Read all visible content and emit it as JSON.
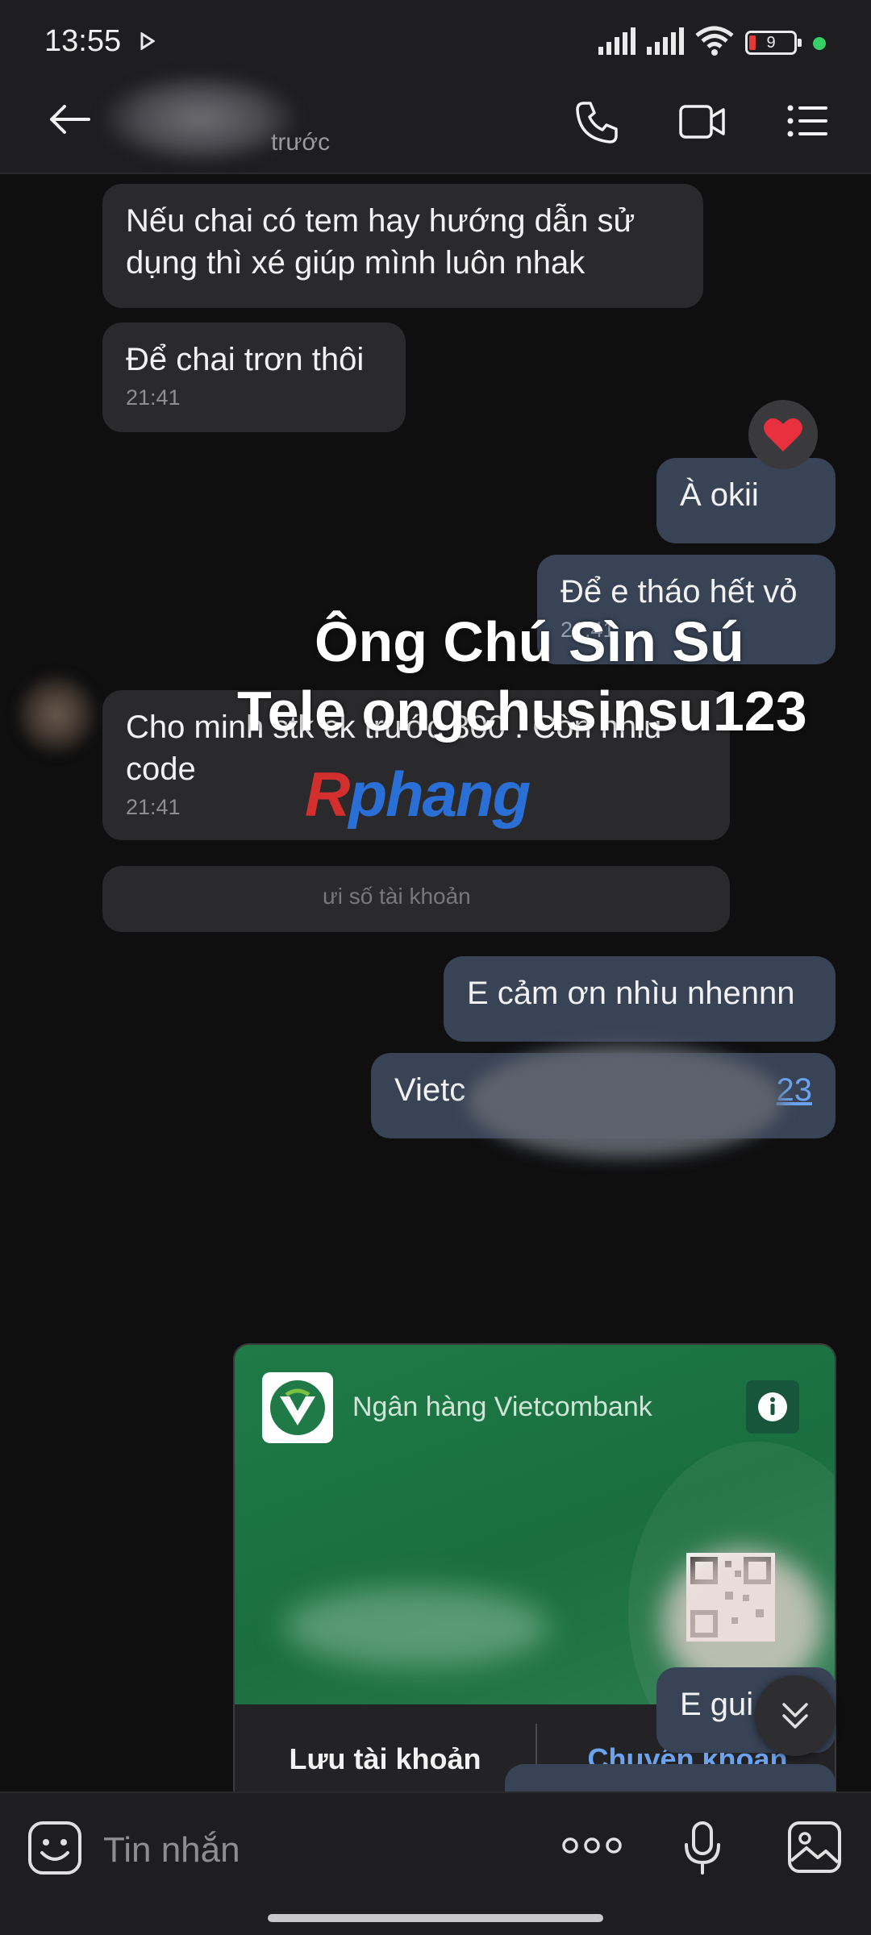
{
  "status_bar": {
    "time": "13:55",
    "battery": "9"
  },
  "header": {
    "subtitle": "trước"
  },
  "messages": [
    {
      "text": "Nếu chai có tem hay hướng dẫn sử dụng thì xé giúp mình luôn nhak"
    },
    {
      "text": "Để chai trơn thôi",
      "time": "21:41"
    },
    {
      "text": "À okii"
    },
    {
      "text": "Để e tháo hết vỏ",
      "time": "21:41"
    },
    {
      "text": "Cho minh stk ck trước 300 . Còn nhiu code",
      "time": "21:41"
    },
    {
      "text": "E cảm ơn nhìu nhennn"
    },
    {
      "text_visible_start": "Vietc",
      "text_visible_end": "23"
    },
    {
      "text": "E gui"
    }
  ],
  "peek_text": "ưi số tài khoản",
  "watermark": {
    "line1": "Ông Chú Sìn Sú",
    "line2": "Tele ongchusinsu123",
    "logo_r": "R",
    "logo_rest": "phang"
  },
  "bank_card": {
    "bank_name": "Ngân hàng Vietcombank",
    "save_label": "Lưu tài khoản",
    "transfer_label": "Chuyển khoản"
  },
  "input": {
    "placeholder": "Tin nhắn"
  },
  "colors": {
    "incoming_bubble": "#2a2a2c",
    "outgoing_bubble": "#384356",
    "bank_green": "#1f7a47",
    "link_blue": "#6ba3f0"
  }
}
